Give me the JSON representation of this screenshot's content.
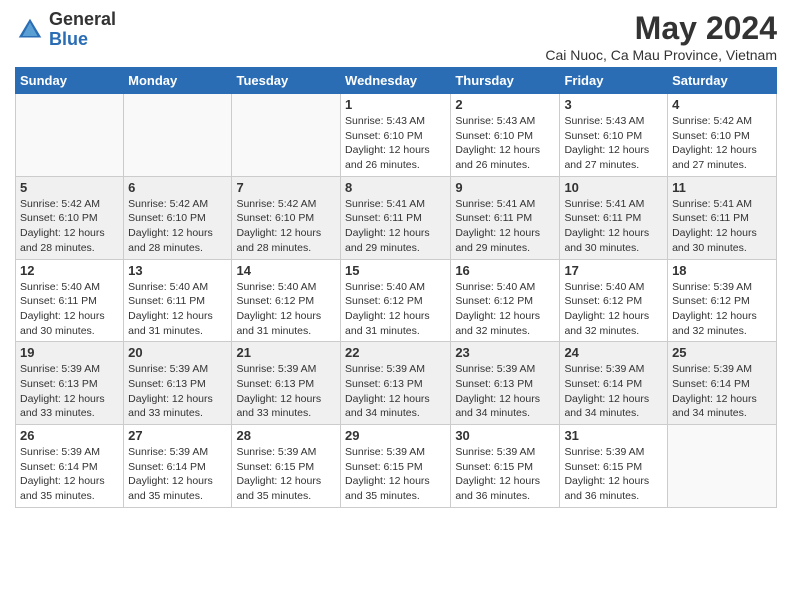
{
  "header": {
    "logo_general": "General",
    "logo_blue": "Blue",
    "month_title": "May 2024",
    "location": "Cai Nuoc, Ca Mau Province, Vietnam"
  },
  "days_of_week": [
    "Sunday",
    "Monday",
    "Tuesday",
    "Wednesday",
    "Thursday",
    "Friday",
    "Saturday"
  ],
  "weeks": [
    [
      {
        "day": "",
        "info": ""
      },
      {
        "day": "",
        "info": ""
      },
      {
        "day": "",
        "info": ""
      },
      {
        "day": "1",
        "info": "Sunrise: 5:43 AM\nSunset: 6:10 PM\nDaylight: 12 hours\nand 26 minutes."
      },
      {
        "day": "2",
        "info": "Sunrise: 5:43 AM\nSunset: 6:10 PM\nDaylight: 12 hours\nand 26 minutes."
      },
      {
        "day": "3",
        "info": "Sunrise: 5:43 AM\nSunset: 6:10 PM\nDaylight: 12 hours\nand 27 minutes."
      },
      {
        "day": "4",
        "info": "Sunrise: 5:42 AM\nSunset: 6:10 PM\nDaylight: 12 hours\nand 27 minutes."
      }
    ],
    [
      {
        "day": "5",
        "info": "Sunrise: 5:42 AM\nSunset: 6:10 PM\nDaylight: 12 hours\nand 28 minutes."
      },
      {
        "day": "6",
        "info": "Sunrise: 5:42 AM\nSunset: 6:10 PM\nDaylight: 12 hours\nand 28 minutes."
      },
      {
        "day": "7",
        "info": "Sunrise: 5:42 AM\nSunset: 6:10 PM\nDaylight: 12 hours\nand 28 minutes."
      },
      {
        "day": "8",
        "info": "Sunrise: 5:41 AM\nSunset: 6:11 PM\nDaylight: 12 hours\nand 29 minutes."
      },
      {
        "day": "9",
        "info": "Sunrise: 5:41 AM\nSunset: 6:11 PM\nDaylight: 12 hours\nand 29 minutes."
      },
      {
        "day": "10",
        "info": "Sunrise: 5:41 AM\nSunset: 6:11 PM\nDaylight: 12 hours\nand 30 minutes."
      },
      {
        "day": "11",
        "info": "Sunrise: 5:41 AM\nSunset: 6:11 PM\nDaylight: 12 hours\nand 30 minutes."
      }
    ],
    [
      {
        "day": "12",
        "info": "Sunrise: 5:40 AM\nSunset: 6:11 PM\nDaylight: 12 hours\nand 30 minutes."
      },
      {
        "day": "13",
        "info": "Sunrise: 5:40 AM\nSunset: 6:11 PM\nDaylight: 12 hours\nand 31 minutes."
      },
      {
        "day": "14",
        "info": "Sunrise: 5:40 AM\nSunset: 6:12 PM\nDaylight: 12 hours\nand 31 minutes."
      },
      {
        "day": "15",
        "info": "Sunrise: 5:40 AM\nSunset: 6:12 PM\nDaylight: 12 hours\nand 31 minutes."
      },
      {
        "day": "16",
        "info": "Sunrise: 5:40 AM\nSunset: 6:12 PM\nDaylight: 12 hours\nand 32 minutes."
      },
      {
        "day": "17",
        "info": "Sunrise: 5:40 AM\nSunset: 6:12 PM\nDaylight: 12 hours\nand 32 minutes."
      },
      {
        "day": "18",
        "info": "Sunrise: 5:39 AM\nSunset: 6:12 PM\nDaylight: 12 hours\nand 32 minutes."
      }
    ],
    [
      {
        "day": "19",
        "info": "Sunrise: 5:39 AM\nSunset: 6:13 PM\nDaylight: 12 hours\nand 33 minutes."
      },
      {
        "day": "20",
        "info": "Sunrise: 5:39 AM\nSunset: 6:13 PM\nDaylight: 12 hours\nand 33 minutes."
      },
      {
        "day": "21",
        "info": "Sunrise: 5:39 AM\nSunset: 6:13 PM\nDaylight: 12 hours\nand 33 minutes."
      },
      {
        "day": "22",
        "info": "Sunrise: 5:39 AM\nSunset: 6:13 PM\nDaylight: 12 hours\nand 34 minutes."
      },
      {
        "day": "23",
        "info": "Sunrise: 5:39 AM\nSunset: 6:13 PM\nDaylight: 12 hours\nand 34 minutes."
      },
      {
        "day": "24",
        "info": "Sunrise: 5:39 AM\nSunset: 6:14 PM\nDaylight: 12 hours\nand 34 minutes."
      },
      {
        "day": "25",
        "info": "Sunrise: 5:39 AM\nSunset: 6:14 PM\nDaylight: 12 hours\nand 34 minutes."
      }
    ],
    [
      {
        "day": "26",
        "info": "Sunrise: 5:39 AM\nSunset: 6:14 PM\nDaylight: 12 hours\nand 35 minutes."
      },
      {
        "day": "27",
        "info": "Sunrise: 5:39 AM\nSunset: 6:14 PM\nDaylight: 12 hours\nand 35 minutes."
      },
      {
        "day": "28",
        "info": "Sunrise: 5:39 AM\nSunset: 6:15 PM\nDaylight: 12 hours\nand 35 minutes."
      },
      {
        "day": "29",
        "info": "Sunrise: 5:39 AM\nSunset: 6:15 PM\nDaylight: 12 hours\nand 35 minutes."
      },
      {
        "day": "30",
        "info": "Sunrise: 5:39 AM\nSunset: 6:15 PM\nDaylight: 12 hours\nand 36 minutes."
      },
      {
        "day": "31",
        "info": "Sunrise: 5:39 AM\nSunset: 6:15 PM\nDaylight: 12 hours\nand 36 minutes."
      },
      {
        "day": "",
        "info": ""
      }
    ]
  ]
}
